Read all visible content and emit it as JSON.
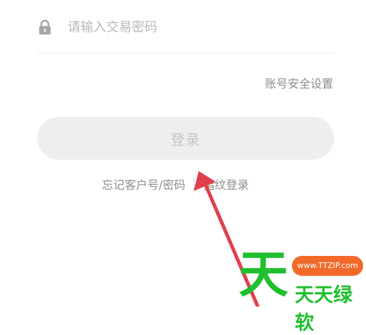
{
  "password_field": {
    "icon": "lock-icon",
    "placeholder": "请输入交易密码"
  },
  "account_security_link": "账号安全设置",
  "login_button_label": "登录",
  "bottom_links": {
    "forgot": "忘记客户号/密码",
    "fingerprint": "指纹登录"
  },
  "watermark": {
    "logo_char": "天",
    "url": "www.TTZIP.com",
    "name": "天天绿软"
  },
  "colors": {
    "arrow": "#e0404d",
    "watermark_green": "#1fbf2d",
    "watermark_orange": "#f16a2a"
  }
}
